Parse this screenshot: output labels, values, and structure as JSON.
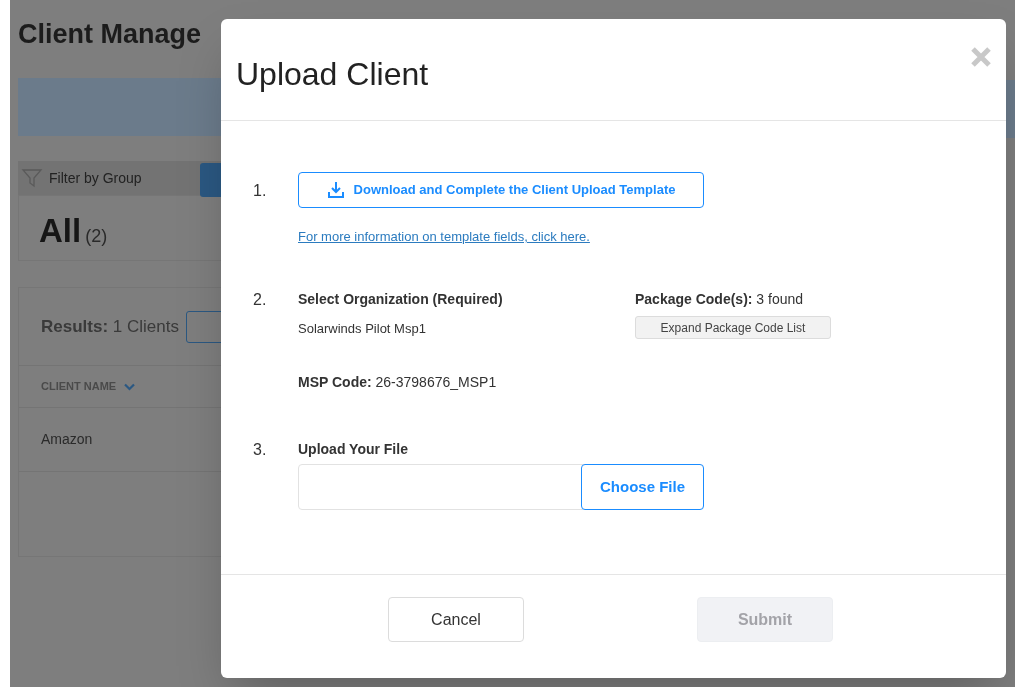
{
  "page": {
    "title": "Client Manage",
    "filter": {
      "label": "Filter by Group"
    },
    "group": {
      "name": "All",
      "count": "(2)"
    },
    "results": {
      "label": "Results:",
      "value": "1 Clients"
    },
    "table": {
      "columns": [
        {
          "label": "CLIENT NAME"
        }
      ],
      "rows": [
        {
          "client_name": "Amazon"
        }
      ]
    }
  },
  "modal": {
    "title": "Upload Client",
    "step_1": {
      "number": "1.",
      "download_button": "Download and Complete the Client Upload Template",
      "help_link": "For more information on template fields, click here."
    },
    "step_2": {
      "number": "2.",
      "label": "Select Organization (Required)",
      "organization": "Solarwinds Pilot Msp1",
      "package_codes": {
        "label": "Package Code(s):",
        "value": "3 found"
      },
      "expand_button": "Expand Package Code List",
      "msp_code": {
        "label": "MSP Code:",
        "value": "26-3798676_MSP1"
      }
    },
    "step_3": {
      "number": "3.",
      "label": "Upload Your File",
      "choose_button": "Choose File"
    },
    "buttons": [
      {
        "label": "Cancel",
        "disabled": false
      },
      {
        "label": "Submit",
        "disabled": true
      }
    ]
  }
}
